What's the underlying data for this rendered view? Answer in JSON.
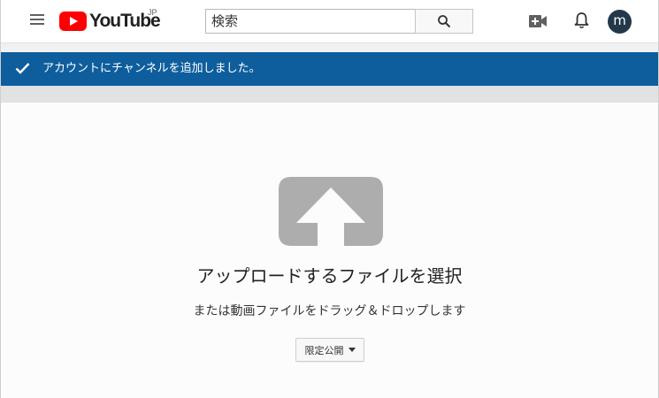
{
  "header": {
    "logo_text": "YouTube",
    "logo_region": "JP",
    "search_placeholder": "検索",
    "avatar_letter": "m"
  },
  "notification": {
    "message": "アカウントにチャンネルを追加しました。"
  },
  "upload": {
    "title": "アップロードするファイルを選択",
    "subtitle": "または動画ファイルをドラッグ＆ドロップします",
    "privacy_label": "限定公開"
  },
  "icons": {
    "menu": "hamburger-menu-icon",
    "search": "search-icon",
    "create": "video-camera-plus-icon",
    "notifications": "bell-icon",
    "check": "check-icon",
    "upload": "upload-arrow-icon",
    "dropdown": "caret-down-icon"
  },
  "colors": {
    "brand_red": "#ff0000",
    "notice_blue": "#0e5e9d",
    "avatar_bg": "#23394a",
    "upload_icon_gray": "#adadad"
  }
}
